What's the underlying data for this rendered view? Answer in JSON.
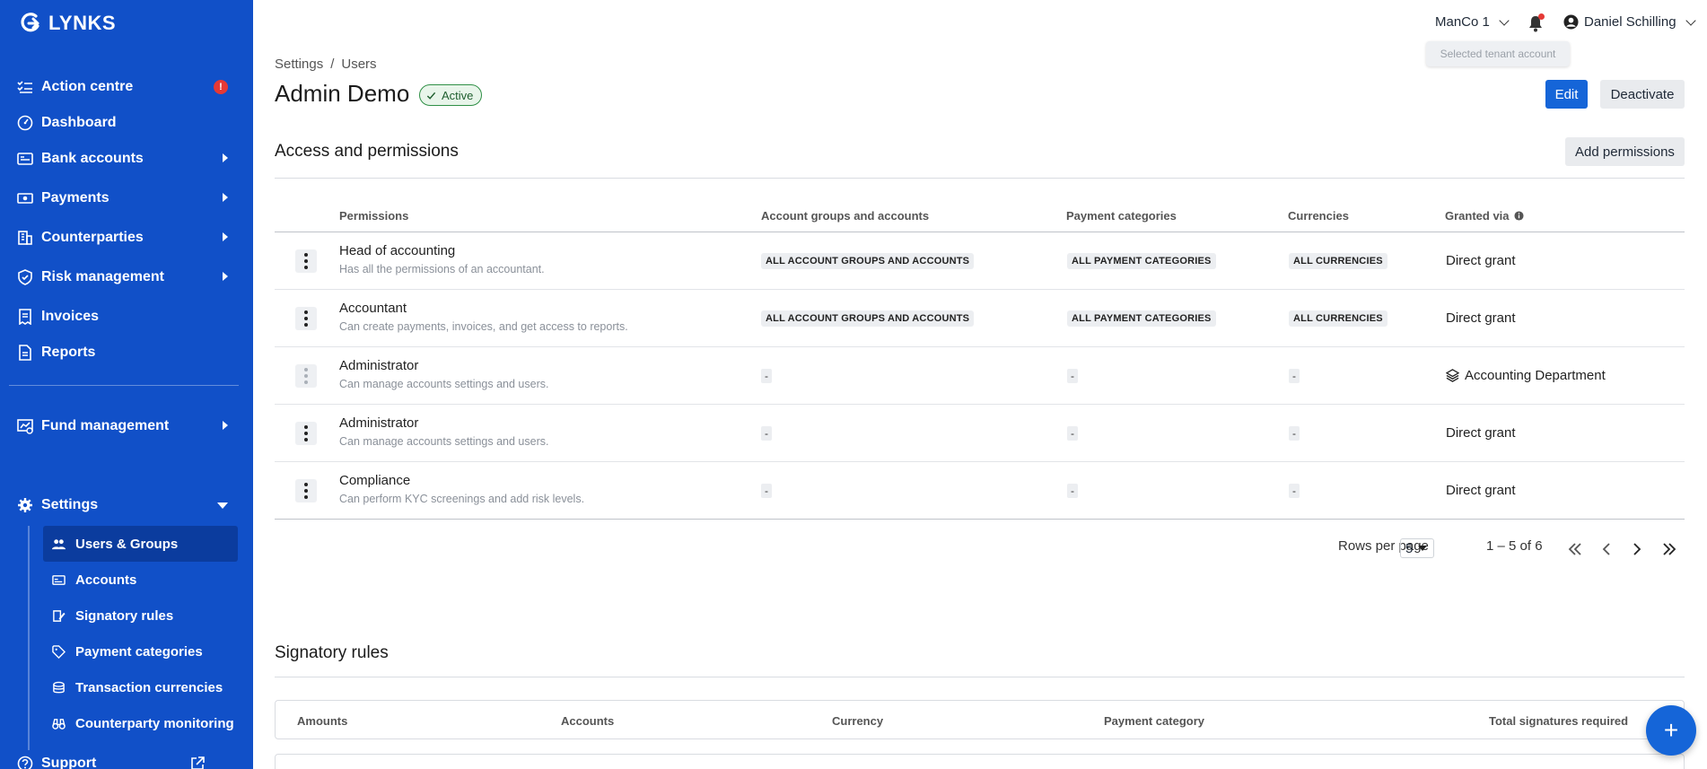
{
  "app": {
    "logo_text": "LYNKS"
  },
  "sidebar": {
    "items": [
      {
        "label": "Action centre",
        "icon": "checklist-icon",
        "badge": "!"
      },
      {
        "label": "Dashboard",
        "icon": "gauge-icon"
      },
      {
        "label": "Bank accounts",
        "icon": "bank-card-icon"
      },
      {
        "label": "Payments",
        "icon": "money-icon"
      },
      {
        "label": "Counterparties",
        "icon": "building-icon"
      },
      {
        "label": "Risk management",
        "icon": "shield-check-icon"
      },
      {
        "label": "Invoices",
        "icon": "receipt-icon"
      },
      {
        "label": "Reports",
        "icon": "document-icon"
      },
      {
        "label": "Fund management",
        "icon": "fund-chart-icon"
      },
      {
        "label": "Settings",
        "icon": "gear-icon"
      },
      {
        "label": "Support",
        "icon": "help-circle-icon"
      }
    ],
    "settings_sub": [
      {
        "label": "Users & Groups",
        "icon": "users-icon"
      },
      {
        "label": "Accounts",
        "icon": "card-icon"
      },
      {
        "label": "Signatory rules",
        "icon": "signature-icon"
      },
      {
        "label": "Payment categories",
        "icon": "tag-icon"
      },
      {
        "label": "Transaction currencies",
        "icon": "coins-icon"
      },
      {
        "label": "Counterparty monitoring",
        "icon": "binoculars-icon"
      }
    ]
  },
  "topbar": {
    "tenant": "ManCo 1",
    "tenant_tooltip": "Selected tenant account",
    "user": "Daniel Schilling"
  },
  "header": {
    "breadcrumb": [
      "Settings",
      "/",
      "Users"
    ],
    "title": "Admin Demo",
    "status": "Active",
    "edit_label": "Edit",
    "deactivate_label": "Deactivate"
  },
  "access": {
    "title": "Access and permissions",
    "add_label": "Add permissions",
    "columns": [
      "Permissions",
      "Account groups and accounts",
      "Payment categories",
      "Currencies",
      "Granted via"
    ],
    "rows": [
      {
        "name": "Head of accounting",
        "desc": "Has all the permissions of an accountant.",
        "accounts": "ALL ACCOUNT GROUPS AND ACCOUNTS",
        "categories": "ALL PAYMENT CATEGORIES",
        "currencies": "ALL CURRENCIES",
        "granted": "Direct grant"
      },
      {
        "name": "Accountant",
        "desc": "Can create payments, invoices, and get access to reports.",
        "accounts": "ALL ACCOUNT GROUPS AND ACCOUNTS",
        "categories": "ALL PAYMENT CATEGORIES",
        "currencies": "ALL CURRENCIES",
        "granted": "Direct grant"
      },
      {
        "name": "Administrator",
        "desc": "Can manage accounts settings and users.",
        "accounts": "-",
        "categories": "-",
        "currencies": "-",
        "granted": "Accounting Department"
      },
      {
        "name": "Administrator",
        "desc": "Can manage accounts settings and users.",
        "accounts": "-",
        "categories": "-",
        "currencies": "-",
        "granted": "Direct grant"
      },
      {
        "name": "Compliance",
        "desc": "Can perform KYC screenings and add risk levels.",
        "accounts": "-",
        "categories": "-",
        "currencies": "-",
        "granted": "Direct grant"
      }
    ],
    "pagination": {
      "rows_per_page_label": "Rows per page",
      "rows_per_page": "5",
      "range": "1 – 5 of 6"
    }
  },
  "signatory": {
    "title": "Signatory rules",
    "columns": [
      "Amounts",
      "Accounts",
      "Currency",
      "Payment category",
      "Total signatures required"
    ]
  },
  "fab": {
    "label": "+"
  },
  "colors": {
    "sidebar": "#1150c8",
    "primary": "#1565d8",
    "active_badge": "#2f8f46",
    "alert": "#e53935"
  }
}
